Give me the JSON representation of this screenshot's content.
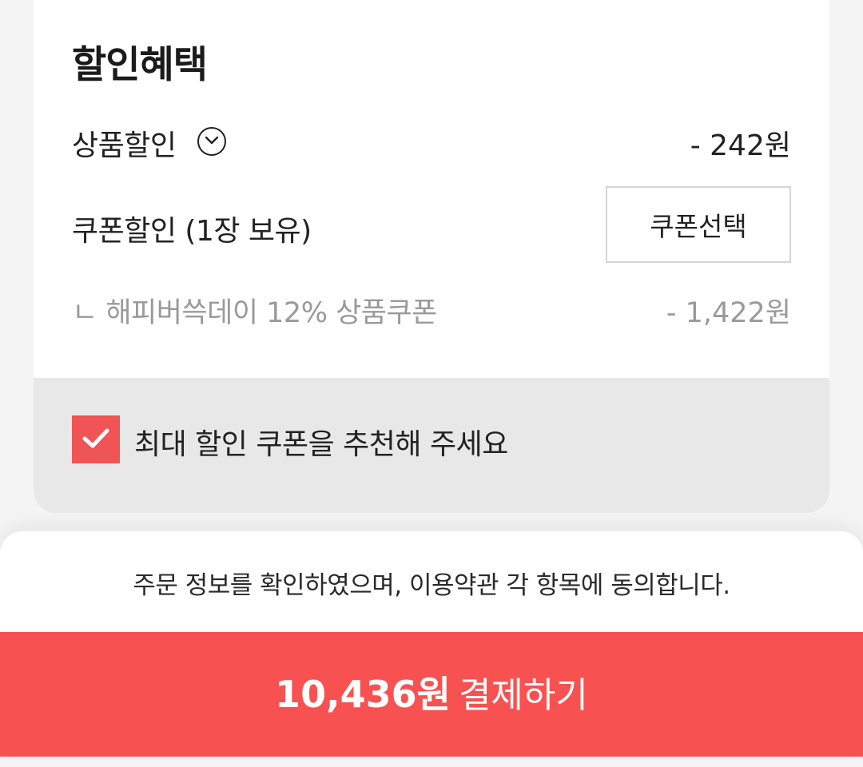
{
  "discount_section": {
    "title": "할인혜택",
    "product_discount": {
      "label": "상품할인",
      "value": "- 242원"
    },
    "coupon_discount": {
      "label": "쿠폰할인 (1장 보유)",
      "select_button_label": "쿠폰선택"
    },
    "applied_coupon": {
      "label": "ㄴ 해피버쓱데이 12% 상품쿠폰",
      "value": "- 1,422원"
    },
    "recommend": {
      "checked": true,
      "label": "최대 할인 쿠폰을 추천해 주세요"
    }
  },
  "footer": {
    "agreement_text": "주문 정보를 확인하였으며, 이용약관 각 항목에 동의합니다.",
    "pay_button": {
      "amount": "10,436원",
      "label": "결제하기"
    }
  },
  "colors": {
    "accent": "#f85151",
    "checkbox": "#f05454",
    "muted_text": "#9a9a9a",
    "recommend_bg": "#e8e8e8"
  },
  "icons": {
    "expand": "chevron-down-icon",
    "check": "checkmark-icon"
  }
}
